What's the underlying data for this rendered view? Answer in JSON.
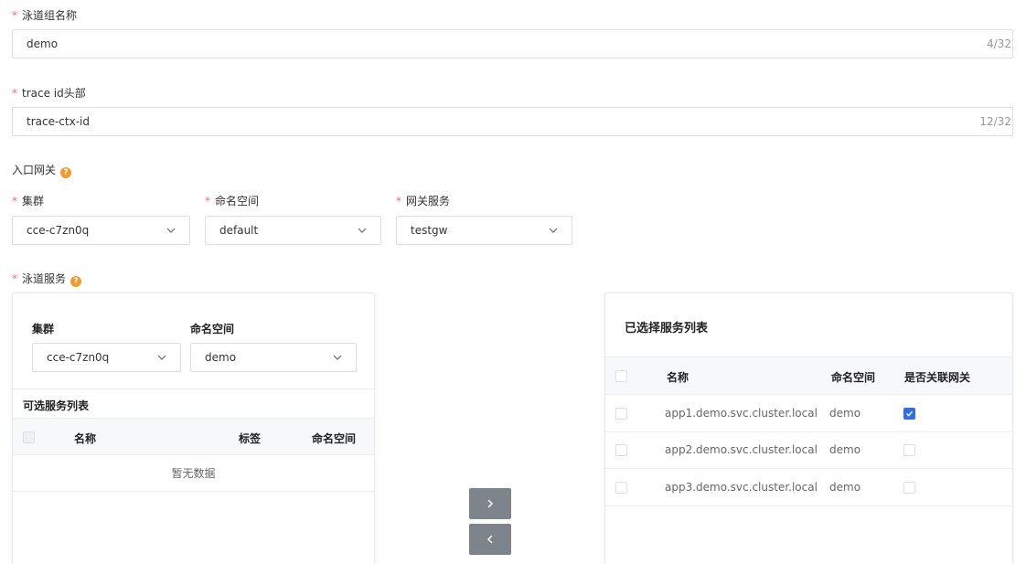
{
  "form": {
    "lane_group_name": {
      "label": "泳道组名称",
      "value": "demo",
      "count": "4/32"
    },
    "trace_header": {
      "label": "trace id头部",
      "value": "trace-ctx-id",
      "count": "12/32"
    },
    "ingress": {
      "label": "入口网关",
      "cluster": {
        "label": "集群",
        "value": "cce-c7zn0q"
      },
      "namespace": {
        "label": "命名空间",
        "value": "default"
      },
      "gateway_service": {
        "label": "网关服务",
        "value": "testgw"
      }
    },
    "lane_service": {
      "label": "泳道服务"
    }
  },
  "left_panel": {
    "cluster": {
      "label": "集群",
      "value": "cce-c7zn0q"
    },
    "namespace": {
      "label": "命名空间",
      "value": "demo"
    },
    "list_title": "可选服务列表",
    "columns": [
      "名称",
      "标签",
      "命名空间"
    ],
    "empty_text": "暂无数据"
  },
  "transfer": {
    "right_icon": "chevron-right-icon",
    "left_icon": "chevron-left-icon"
  },
  "right_panel": {
    "title": "已选择服务列表",
    "columns": [
      "名称",
      "命名空间",
      "是否关联网关"
    ],
    "rows": [
      {
        "name": "app1.demo.svc.cluster.local",
        "namespace": "demo",
        "linked": true
      },
      {
        "name": "app2.demo.svc.cluster.local",
        "namespace": "demo",
        "linked": false
      },
      {
        "name": "app3.demo.svc.cluster.local",
        "namespace": "demo",
        "linked": false
      }
    ]
  },
  "colors": {
    "required": "#f56c6c",
    "help": "#f39a2d",
    "checkbox_checked": "#2f6ee8",
    "transfer_button": "#7e848c"
  }
}
